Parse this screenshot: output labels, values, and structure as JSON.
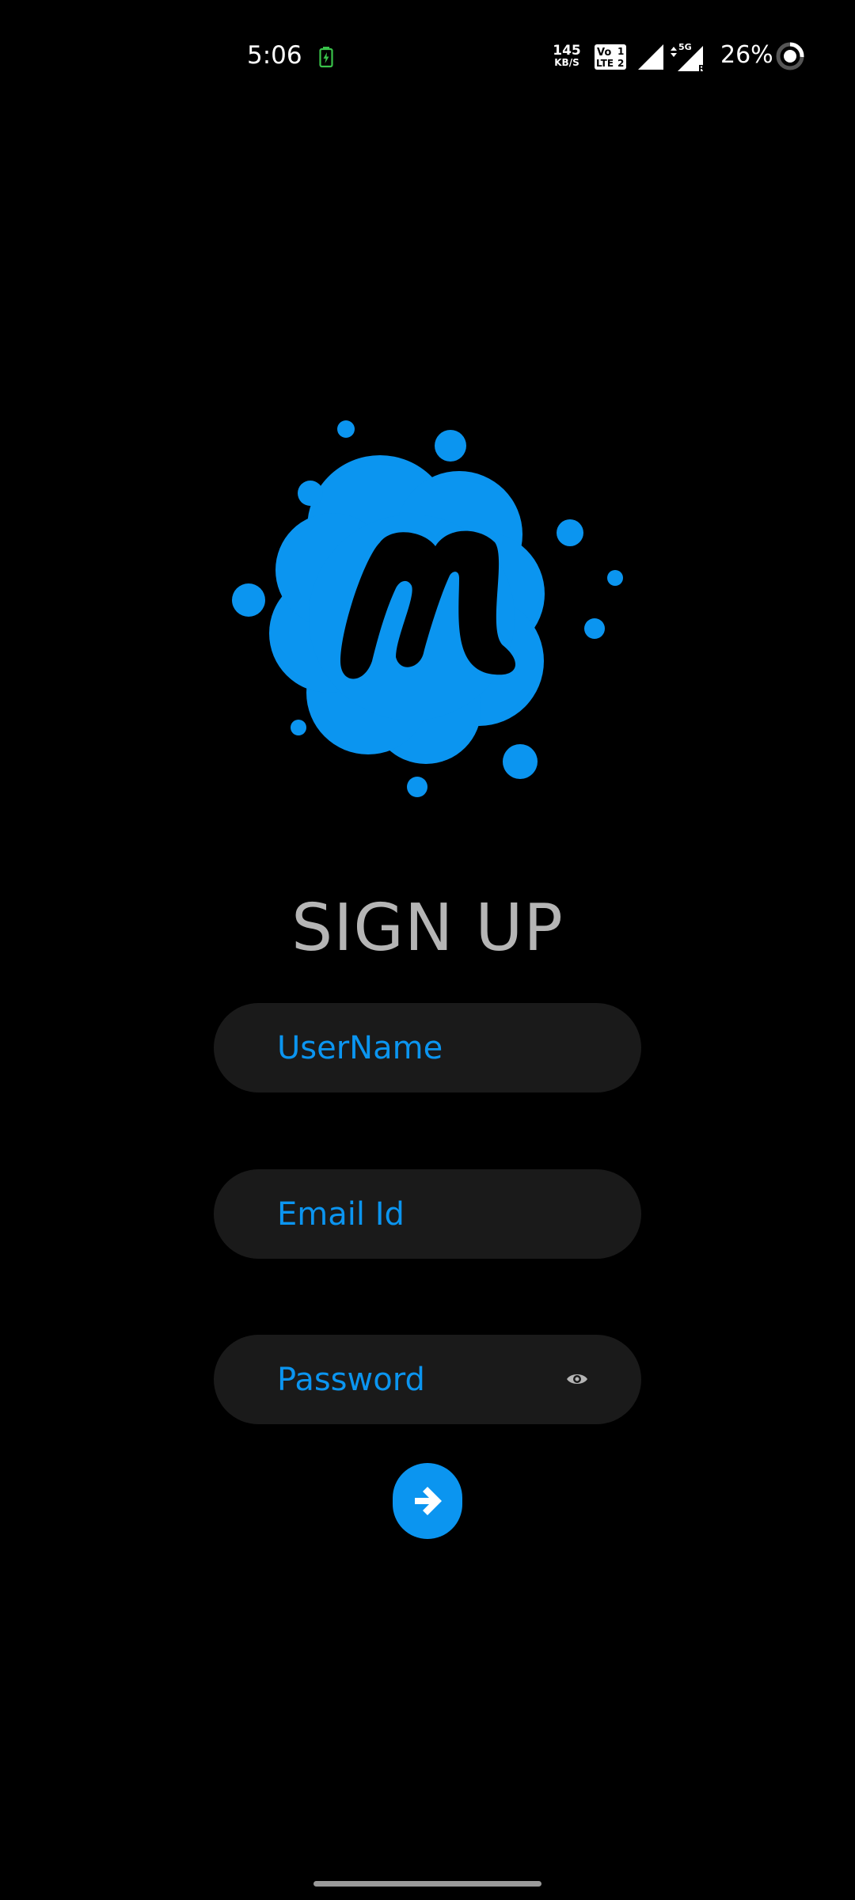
{
  "status_bar": {
    "time": "5:06",
    "net_speed_value": "145",
    "net_speed_unit": "KB/S",
    "volte_label_top": "Vo",
    "volte_label_bottom": "LTE",
    "sim1": "1",
    "sim2": "2",
    "network_type": "5G",
    "roaming": "R",
    "battery_percent": "26%",
    "battery_level": 0.26,
    "icons": [
      "battery-charging-icon",
      "volte-icon",
      "signal-icon",
      "signal-5g-icon",
      "battery-ring-icon"
    ]
  },
  "logo": {
    "name": "meetup-logo",
    "letter": "m",
    "color": "#0b95f0"
  },
  "heading": "SIGN UP",
  "form": {
    "username_placeholder": "UserName",
    "email_placeholder": "Email Id",
    "password_placeholder": "Password",
    "password_toggle_icon": "eye-icon",
    "submit_icon": "arrow-right-icon"
  },
  "colors": {
    "background": "#000000",
    "accent": "#0b95f0",
    "field_background": "#1a1a1a",
    "heading": "#b5b5b5"
  }
}
